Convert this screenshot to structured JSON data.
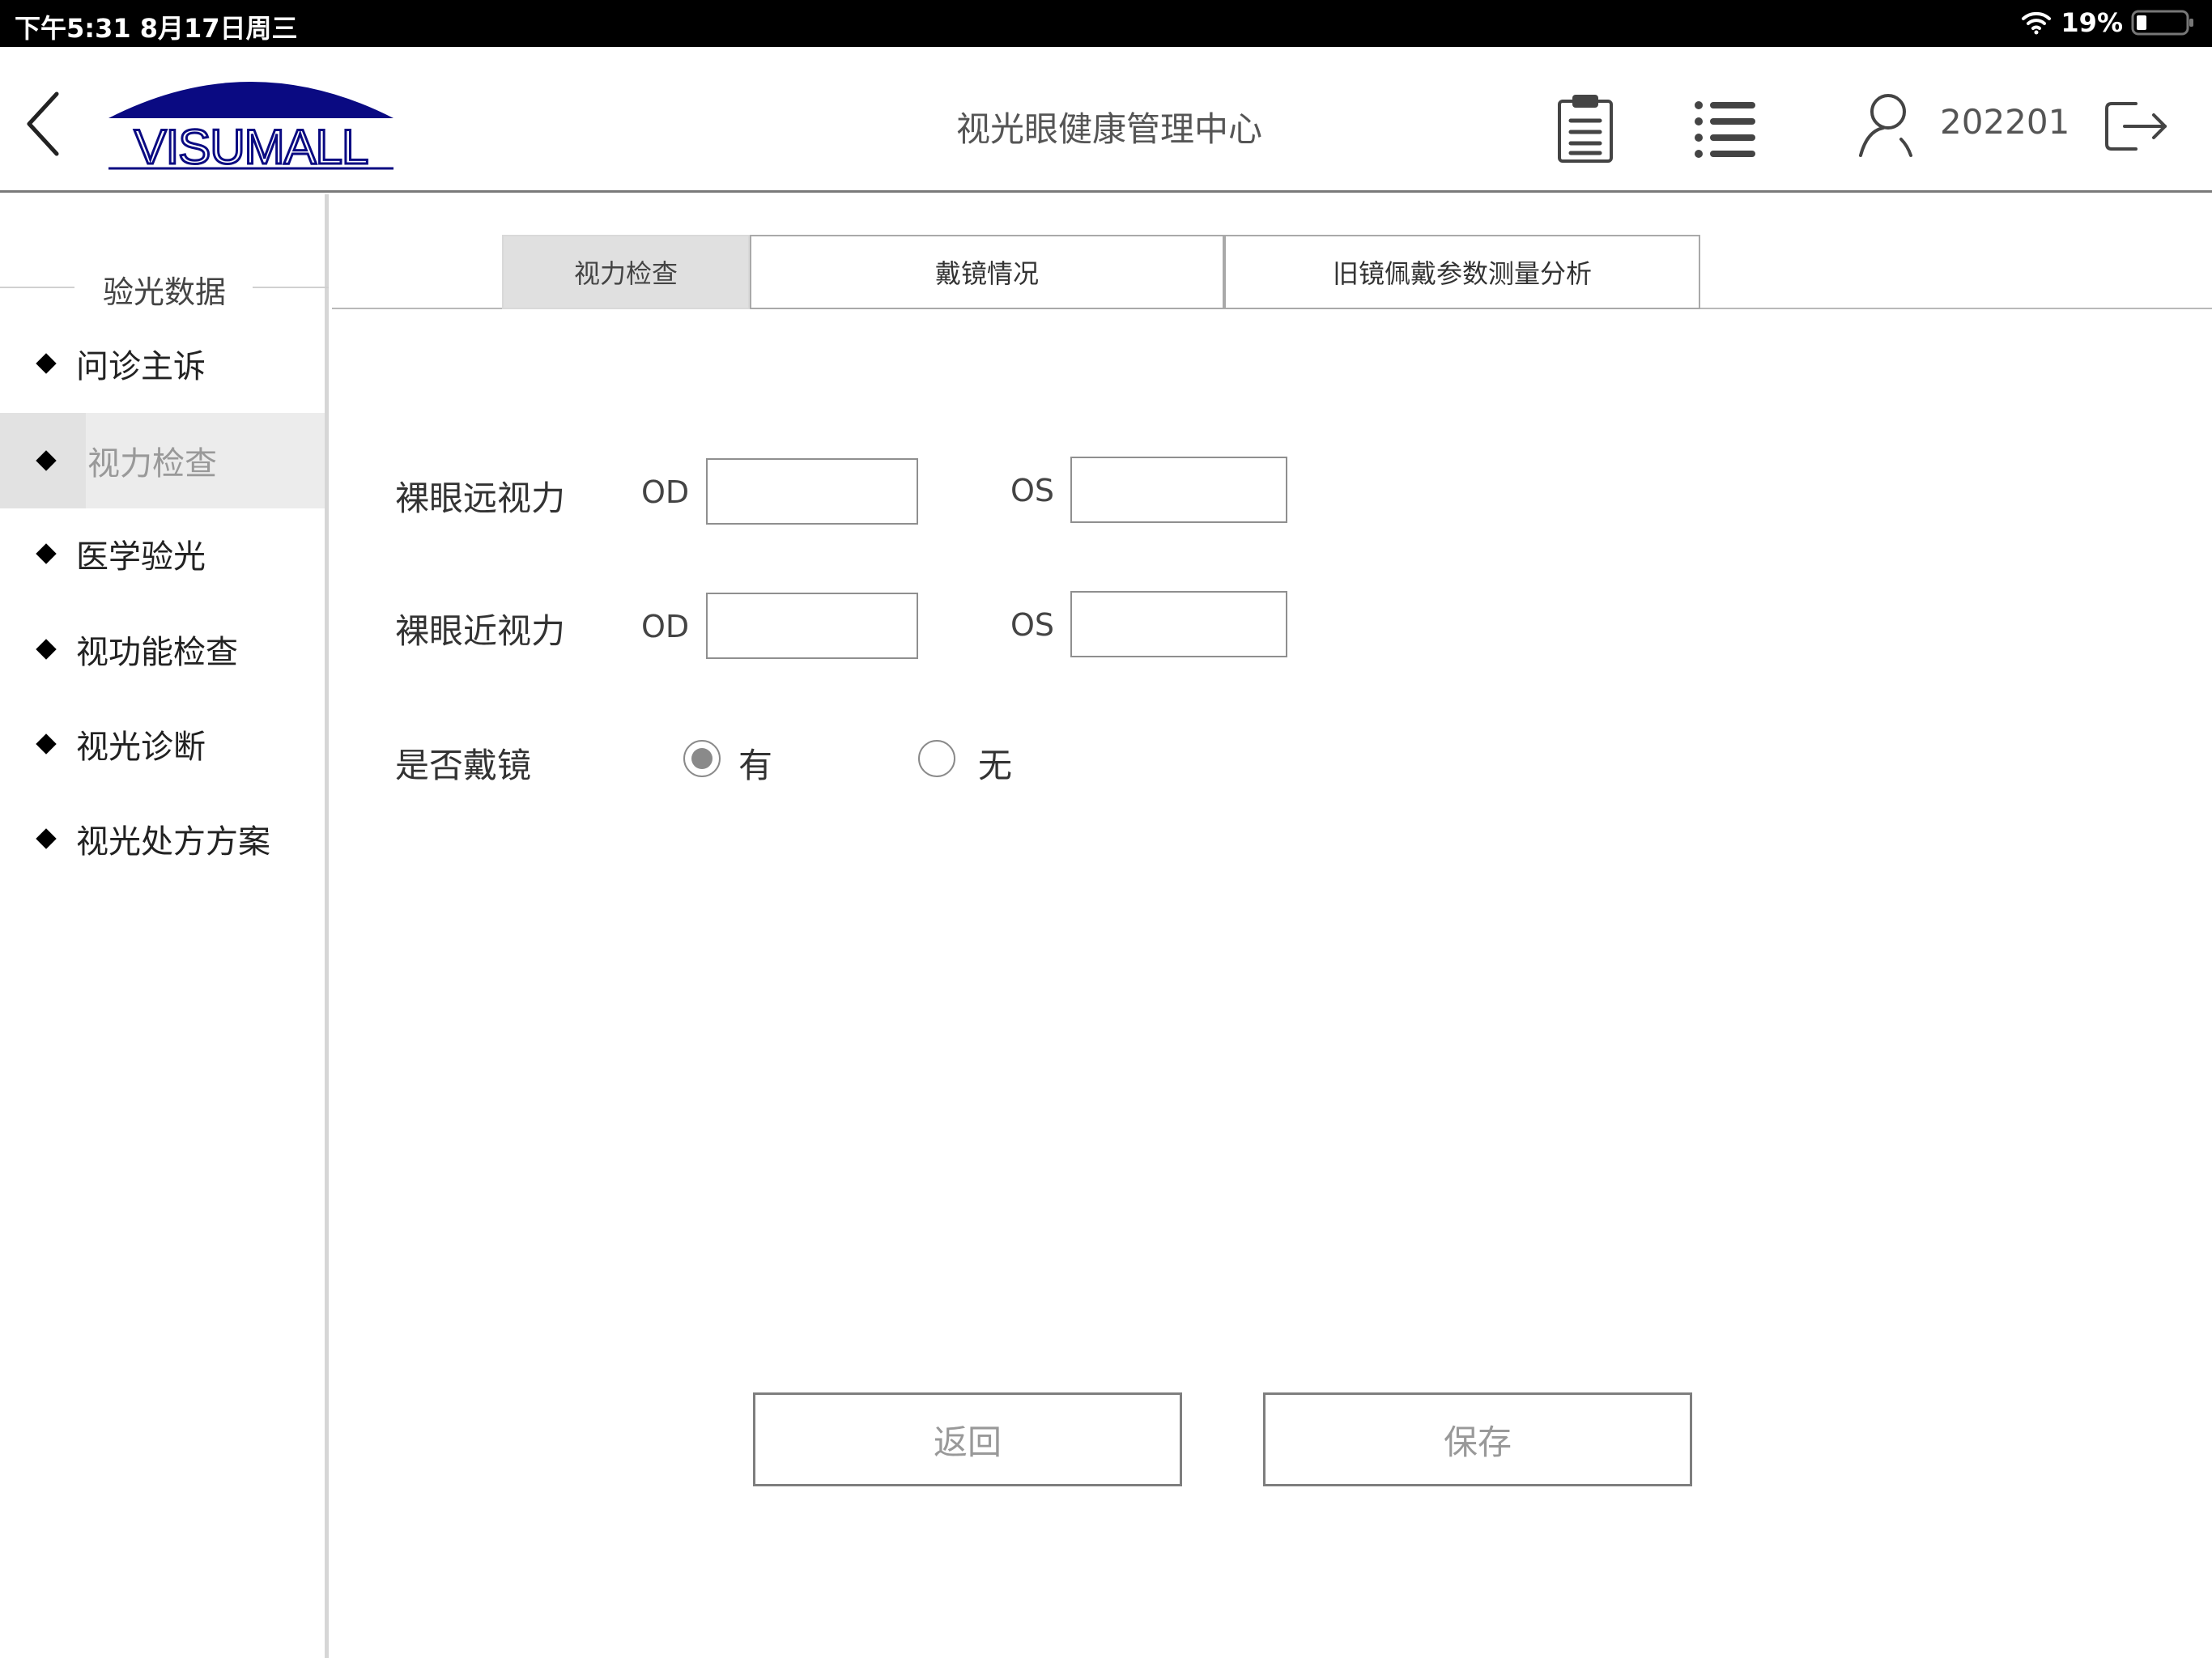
{
  "status_bar": {
    "time": "下午5:31   8月17日周三",
    "battery_pct": "19%"
  },
  "header": {
    "title": "视光眼健康管理中心",
    "logo_text": "VISUMALL",
    "user_id": "202201"
  },
  "sidebar": {
    "heading": "验光数据",
    "items": [
      {
        "label": "问诊主诉"
      },
      {
        "label": "视力检查"
      },
      {
        "label": "医学验光"
      },
      {
        "label": "视功能检查"
      },
      {
        "label": "视光诊断"
      },
      {
        "label": "视光处方方案"
      }
    ]
  },
  "tabs": [
    {
      "label": "视力检查"
    },
    {
      "label": "戴镜情况"
    },
    {
      "label": "旧镜佩戴参数测量分析"
    }
  ],
  "form": {
    "far_label": "裸眼远视力",
    "near_label": "裸眼近视力",
    "glasses_label": "是否戴镜",
    "od": "OD",
    "os": "OS",
    "far_od_value": "",
    "far_os_value": "",
    "near_od_value": "",
    "near_os_value": "",
    "opt_yes": "有",
    "opt_no": "无"
  },
  "buttons": {
    "back": "返回",
    "save": "保存"
  }
}
